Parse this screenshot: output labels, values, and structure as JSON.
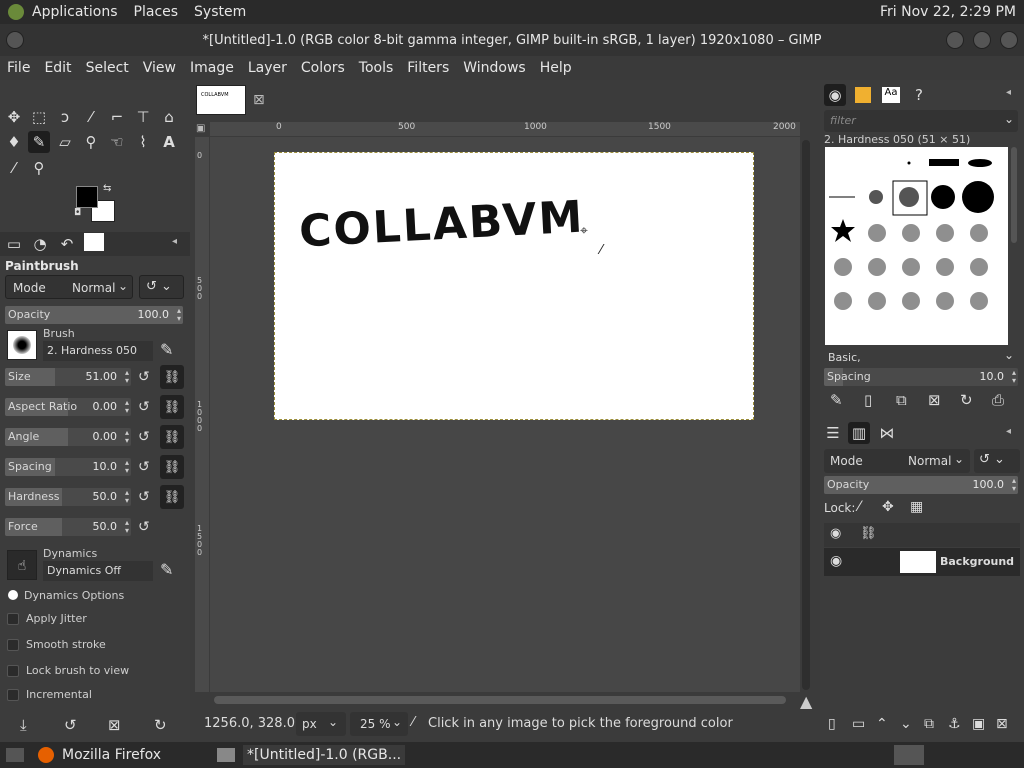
{
  "system_bar": {
    "menus": [
      "Applications",
      "Places",
      "System"
    ],
    "clock": "Fri Nov 22,  2:29 PM"
  },
  "window": {
    "title": "*[Untitled]-1.0 (RGB color 8-bit gamma integer, GIMP built-in sRGB, 1 layer) 1920x1080 – GIMP"
  },
  "menubar": [
    "File",
    "Edit",
    "Select",
    "View",
    "Image",
    "Layer",
    "Colors",
    "Tools",
    "Filters",
    "Windows",
    "Help"
  ],
  "tool_options": {
    "title": "Paintbrush",
    "mode_label": "Mode",
    "mode_value": "Normal",
    "opacity": {
      "label": "Opacity",
      "value": "100.0",
      "fraction": 1.0
    },
    "brush_label": "Brush",
    "brush_name": "2. Hardness 050",
    "sliders": [
      {
        "label": "Size",
        "value": "51.00",
        "fraction": 0.4
      },
      {
        "label": "Aspect Ratio",
        "value": "0.00",
        "fraction": 0.5
      },
      {
        "label": "Angle",
        "value": "0.00",
        "fraction": 0.5
      },
      {
        "label": "Spacing",
        "value": "10.0",
        "fraction": 0.4
      },
      {
        "label": "Hardness",
        "value": "50.0",
        "fraction": 0.45
      },
      {
        "label": "Force",
        "value": "50.0",
        "fraction": 0.45
      }
    ],
    "dynamics_label": "Dynamics",
    "dynamics_value": "Dynamics Off",
    "dynamics_options": "Dynamics Options",
    "checkboxes": [
      "Apply Jitter",
      "Smooth stroke",
      "Lock brush to view",
      "Incremental"
    ]
  },
  "canvas": {
    "ruler_ticks": [
      "0",
      "500",
      "1000",
      "1500",
      "2000"
    ],
    "vruler_ticks": [
      "0",
      "5 0 0",
      "1 0 0 0",
      "1 5 0 0"
    ],
    "drawn_text": "COLLABVM"
  },
  "statusbar": {
    "coords": "1256.0, 328.0",
    "unit": "px",
    "zoom": "25 %",
    "message": "Click in any image to pick the foreground color"
  },
  "brushes_panel": {
    "filter_placeholder": "filter",
    "selected_brush": "2. Hardness 050 (51 × 51)",
    "preset": "Basic,",
    "spacing": {
      "label": "Spacing",
      "value": "10.0",
      "fraction": 0.1
    }
  },
  "layers_panel": {
    "mode_label": "Mode",
    "mode_value": "Normal",
    "opacity": {
      "label": "Opacity",
      "value": "100.0",
      "fraction": 1.0
    },
    "lock_label": "Lock:",
    "layer_name": "Background"
  },
  "taskbar": {
    "items": [
      "Mozilla Firefox",
      "*[Untitled]-1.0 (RGB..."
    ]
  }
}
